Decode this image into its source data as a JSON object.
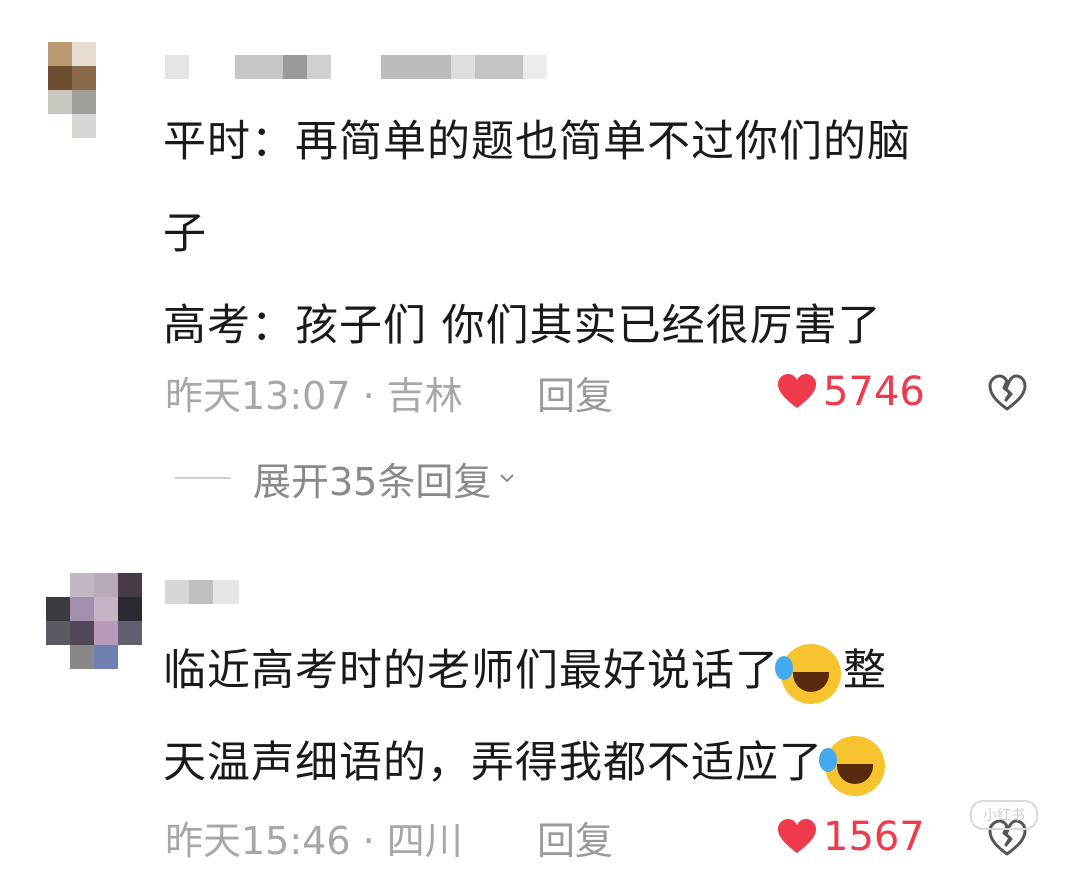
{
  "comments": [
    {
      "lines": [
        "平时：再简单的题也简单不过你们的脑",
        "子",
        "高考：孩子们  你们其实已经很厉害了"
      ],
      "time_location": "昨天13:07 · 吉林",
      "reply_label": "回复",
      "likes": "5746",
      "expand_label": "展开35条回复"
    },
    {
      "line1_a": "临近高考时的老师们最好说话了",
      "line1_b": "整",
      "line2": "天温声细语的，弄得我都不适应了",
      "time_location": "昨天15:46 · 四川",
      "reply_label": "回复",
      "likes": "1567"
    }
  ],
  "watermark": "小红书",
  "colors": {
    "like": "#ee3a4a",
    "meta": "#a7a7a7",
    "text": "#1a1a1a"
  },
  "icons": [
    "heart-filled-icon",
    "heart-broken-icon",
    "chevron-down-icon",
    "rofl-emoji-icon"
  ]
}
